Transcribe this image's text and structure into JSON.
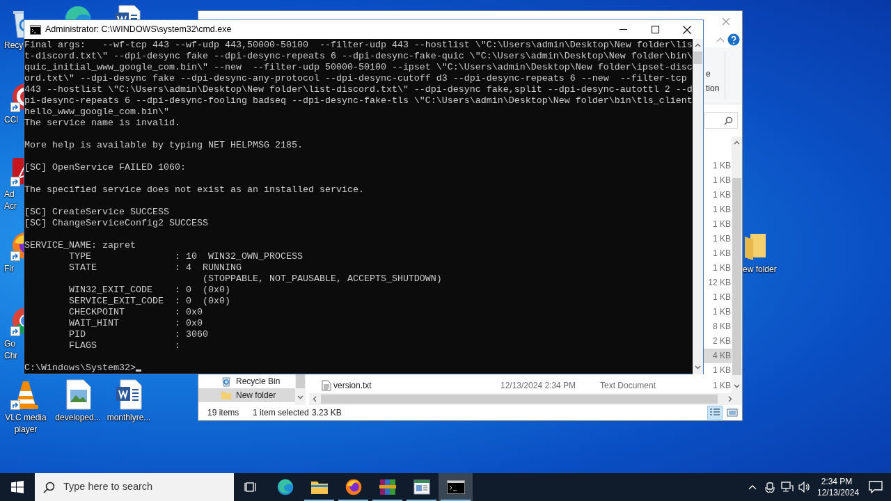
{
  "desktop": {
    "icons": [
      {
        "kind": "recycle",
        "lines": [
          "Recy"
        ],
        "clipped": true,
        "shortcut": false
      },
      {
        "kind": "ccleaner",
        "lines": [
          "CCl"
        ],
        "clipped": true,
        "shortcut": true
      },
      {
        "kind": "acrobat",
        "lines": [
          "Ad",
          "Acr"
        ],
        "clipped": true,
        "shortcut": true
      },
      {
        "kind": "firefox",
        "lines": [
          "Fir"
        ],
        "clipped": true,
        "shortcut": true
      },
      {
        "kind": "chrome",
        "lines": [
          "Go",
          "Chr"
        ],
        "clipped": true,
        "shortcut": true
      },
      {
        "kind": "vlc",
        "lines": [
          "VLC media",
          "player"
        ],
        "clipped": false,
        "shortcut": true
      },
      {
        "kind": "image",
        "lines": [
          "developed..."
        ],
        "clipped": false,
        "shortcut": false
      },
      {
        "kind": "word",
        "lines": [
          "monthlyre..."
        ],
        "clipped": false,
        "shortcut": false
      },
      {
        "kind": "edge",
        "shortcut": false
      },
      {
        "kind": "word",
        "shortcut": false
      },
      {
        "kind": "folder",
        "lines": [
          "ew folder"
        ],
        "clipped": true,
        "shortcut": false
      }
    ]
  },
  "explorer": {
    "ribbon_fragments": [
      "e",
      "tion"
    ],
    "nav": [
      {
        "kind": "recycle",
        "label": "Recycle Bin",
        "selected": false
      },
      {
        "kind": "folder",
        "label": "New folder",
        "selected": true
      }
    ],
    "files": [
      {
        "size": "1 KB",
        "selected": false
      },
      {
        "size": "1 KB",
        "selected": false
      },
      {
        "size": "1 KB",
        "selected": false
      },
      {
        "size": "1 KB",
        "selected": false
      },
      {
        "size": "1 KB",
        "selected": false
      },
      {
        "size": "1 KB",
        "selected": false
      },
      {
        "size": "1 KB",
        "selected": false
      },
      {
        "size": "1 KB",
        "selected": false
      },
      {
        "size": "12 KB",
        "selected": false
      },
      {
        "size": "1 KB",
        "selected": false
      },
      {
        "size": "1 KB",
        "selected": false
      },
      {
        "size": "8 KB",
        "selected": false
      },
      {
        "size": "2 KB",
        "selected": false
      },
      {
        "size": "4 KB",
        "selected": true
      },
      {
        "size": "1 KB",
        "selected": false
      },
      {
        "name": "version.txt",
        "date": "12/13/2024 2:34 PM",
        "type": "Text Document",
        "size": "1 KB",
        "selected": false
      }
    ],
    "status": {
      "count": "19 items",
      "selection": "1 item selected",
      "size": "3.23 KB"
    },
    "views": [
      {
        "kind": "details",
        "selected": true
      },
      {
        "kind": "preview",
        "selected": false
      }
    ]
  },
  "console": {
    "title": "Administrator: C:\\WINDOWS\\system32\\cmd.exe",
    "blocks": [
      [
        "Final args:   --wf-tcp 443 --wf-udp 443,50000-50100  --filter-udp 443 --hostlist \\\"C:\\Users\\admin\\Desktop\\New folder\\lis",
        "t-discord.txt\\\" --dpi-desync fake --dpi-desync-repeats 6 --dpi-desync-fake-quic \\\"C:\\Users\\admin\\Desktop\\New folder\\bin\\",
        "quic_initial_www_google_com.bin\\\" --new  --filter-udp 50000-50100 --ipset \\\"C:\\Users\\admin\\Desktop\\New folder\\ipset-disc",
        "ord.txt\\\" --dpi-desync fake --dpi-desync-any-protocol --dpi-desync-cutoff d3 --dpi-desync-repeats 6 --new  --filter-tcp",
        "443 --hostlist \\\"C:\\Users\\admin\\Desktop\\New folder\\list-discord.txt\\\" --dpi-desync fake,split --dpi-desync-autottl 2 --d",
        "pi-desync-repeats 6 --dpi-desync-fooling badseq --dpi-desync-fake-tls \\\"C:\\Users\\admin\\Desktop\\New folder\\bin\\tls_client",
        "hello_www_google_com.bin\\\"",
        "The service name is invalid."
      ],
      [
        "More help is available by typing NET HELPMSG 2185."
      ],
      [
        "[SC] OpenService FAILED 1060:"
      ],
      [
        "The specified service does not exist as an installed service."
      ],
      [
        "[SC] CreateService SUCCESS",
        "[SC] ChangeServiceConfig2 SUCCESS"
      ],
      [
        "SERVICE_NAME: zapret",
        "        TYPE               : 10  WIN32_OWN_PROCESS",
        "        STATE              : 4  RUNNING",
        "                                (STOPPABLE, NOT_PAUSABLE, ACCEPTS_SHUTDOWN)",
        "        WIN32_EXIT_CODE    : 0  (0x0)",
        "        SERVICE_EXIT_CODE  : 0  (0x0)",
        "        CHECKPOINT         : 0x0",
        "        WAIT_HINT          : 0x0",
        "        PID                : 3060",
        "        FLAGS              :"
      ]
    ],
    "prompt": "C:\\Windows\\System32>"
  },
  "taskbar": {
    "search_placeholder": "Type here to search",
    "apps": [
      {
        "kind": "taskview",
        "running": false,
        "active": false
      },
      {
        "kind": "edge",
        "running": false,
        "active": false
      },
      {
        "kind": "explorer",
        "running": true,
        "active": false
      },
      {
        "kind": "firefox",
        "running": true,
        "active": false
      },
      {
        "kind": "winrar",
        "running": true,
        "active": false
      },
      {
        "kind": "viewer",
        "running": true,
        "active": false
      },
      {
        "kind": "cmd",
        "running": true,
        "active": true
      }
    ],
    "time": "2:34 PM",
    "date": "12/13/2024"
  }
}
